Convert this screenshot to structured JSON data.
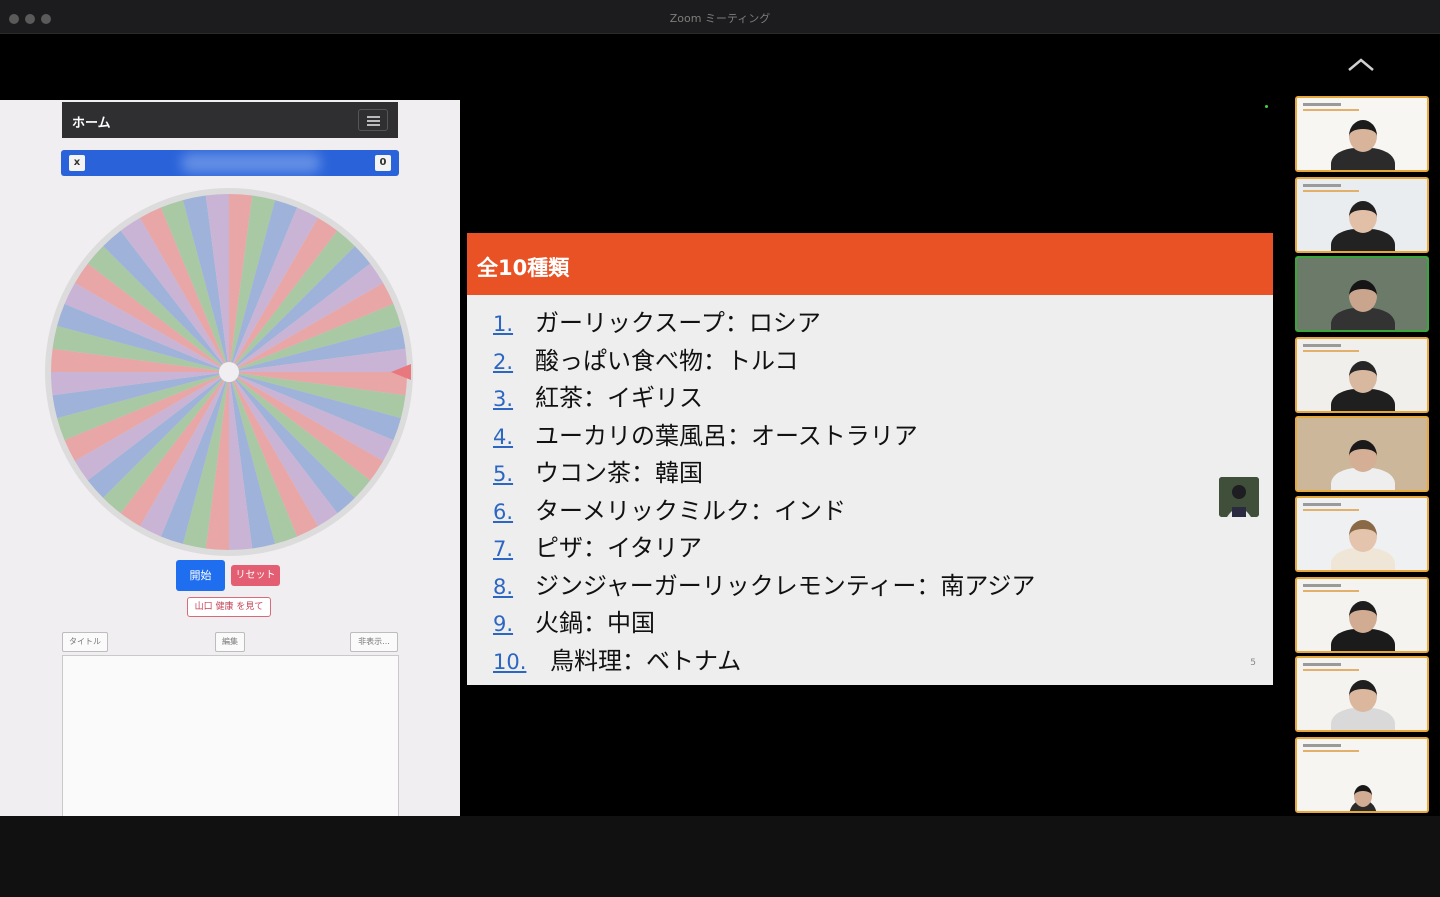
{
  "window": {
    "title": "Zoom ミーティング"
  },
  "web_panel": {
    "header_title": "ホーム",
    "bar_left_button": "x",
    "bar_right_button": "0",
    "start_button": "開始",
    "reset_button": "リセット",
    "name_tag": "山口 健康 を見て",
    "tab_title": "タイトル",
    "tab_edit": "編集",
    "tab_more": "非表示..."
  },
  "slide": {
    "title": "全10種類",
    "items": [
      {
        "num": "1.",
        "text": "ガーリックスープ：ロシア"
      },
      {
        "num": "2.",
        "text": "酸っぱい食べ物：トルコ"
      },
      {
        "num": "3.",
        "text": "紅茶：イギリス"
      },
      {
        "num": "4.",
        "text": "ユーカリの葉風呂：オーストラリア"
      },
      {
        "num": "5.",
        "text": "ウコン茶：韓国"
      },
      {
        "num": "6.",
        "text": "ターメリックミルク：インド"
      },
      {
        "num": "7.",
        "text": "ピザ：イタリア"
      },
      {
        "num": "8.",
        "text": "ジンジャーガーリックレモンティー：南アジア"
      },
      {
        "num": "9.",
        "text": "火鍋：中国"
      },
      {
        "num": "10.",
        "text": "鳥料理：ベトナム"
      }
    ],
    "page_number": "5"
  },
  "participants": [
    {
      "id": "p1",
      "status": "normal"
    },
    {
      "id": "p2",
      "status": "normal"
    },
    {
      "id": "p3",
      "status": "speaking"
    },
    {
      "id": "p4",
      "status": "normal"
    },
    {
      "id": "p5",
      "status": "normal"
    },
    {
      "id": "p6",
      "status": "normal"
    },
    {
      "id": "p7",
      "status": "normal"
    },
    {
      "id": "p8",
      "status": "normal"
    },
    {
      "id": "p9",
      "status": "normal"
    }
  ],
  "colors": {
    "slide_header": "#e95225",
    "link_blue": "#2c66c3",
    "tile_border": "#e7a93c",
    "speaking_border": "#3aa53a"
  }
}
